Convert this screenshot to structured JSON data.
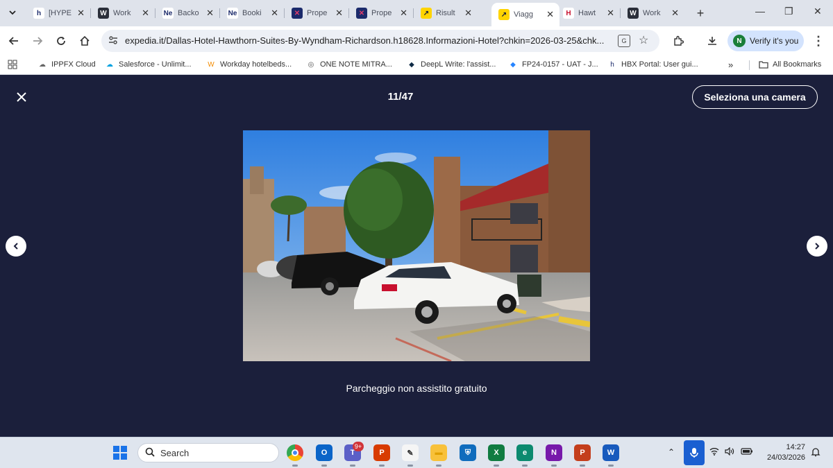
{
  "browser": {
    "tabs": [
      {
        "label": "[HYPE",
        "fav": "h",
        "fav_bg": "#ffffff",
        "fav_color": "#1b2a6b"
      },
      {
        "label": "Work",
        "fav": "W",
        "fav_bg": "#2b2f3a",
        "fav_color": "#ffffff"
      },
      {
        "label": "Backo",
        "fav": "Ne",
        "fav_bg": "#ffffff",
        "fav_color": "#1b2a6b"
      },
      {
        "label": "Booki",
        "fav": "Ne",
        "fav_bg": "#ffffff",
        "fav_color": "#1b2a6b"
      },
      {
        "label": "Prope",
        "fav": "✕",
        "fav_bg": "#1b2a6b",
        "fav_color": "#e23b6a"
      },
      {
        "label": "Prope",
        "fav": "✕",
        "fav_bg": "#1b2a6b",
        "fav_color": "#e23b6a"
      },
      {
        "label": "Risult",
        "fav": "↗",
        "fav_bg": "#ffd400",
        "fav_color": "#1b1f3b"
      },
      {
        "label": "Viagg",
        "fav": "↗",
        "fav_bg": "#ffd400",
        "fav_color": "#1b1f3b"
      },
      {
        "label": "Hawt",
        "fav": "H",
        "fav_bg": "#ffffff",
        "fav_color": "#c8102e"
      },
      {
        "label": "Work",
        "fav": "W",
        "fav_bg": "#2b2f3a",
        "fav_color": "#ffffff"
      }
    ],
    "active_tab": 7,
    "url": "expedia.it/Dallas-Hotel-Hawthorn-Suites-By-Wyndham-Richardson.h18628.Informazioni-Hotel?chkin=2026-03-25&chk...",
    "verify_label": "Verify it's you",
    "bookmarks": [
      {
        "label": "IPPFX Cloud",
        "icon": "☁",
        "icon_color": "#666"
      },
      {
        "label": "Salesforce - Unlimit...",
        "icon": "☁",
        "icon_color": "#00a1e0"
      },
      {
        "label": "Workday hotelbeds...",
        "icon": "W",
        "icon_color": "#f38b00"
      },
      {
        "label": "ONE NOTE MITRA...",
        "icon": "◎",
        "icon_color": "#555"
      },
      {
        "label": "DeepL Write: l'assist...",
        "icon": "◆",
        "icon_color": "#0f2b46"
      },
      {
        "label": "FP24-0157 - UAT - J...",
        "icon": "◆",
        "icon_color": "#2684ff"
      },
      {
        "label": "HBX Portal: User gui...",
        "icon": "h",
        "icon_color": "#1b2a6b"
      }
    ],
    "more_bookmarks": "»",
    "all_bookmarks": "All Bookmarks"
  },
  "gallery": {
    "counter": "11/47",
    "select_room": "Seleziona una camera",
    "caption": "Parcheggio non assistito gratuito"
  },
  "taskbar": {
    "search_placeholder": "Search",
    "apps": [
      {
        "name": "chrome-icon",
        "glyph": "",
        "bg": "#ffffff",
        "color": "#fff"
      },
      {
        "name": "outlook-icon",
        "glyph": "O",
        "bg": "#0a64c8",
        "color": "#fff"
      },
      {
        "name": "teams-icon",
        "glyph": "T",
        "bg": "#5b5fc7",
        "color": "#fff"
      },
      {
        "name": "ppt-viewer-icon",
        "glyph": "P",
        "bg": "#d83b01",
        "color": "#fff"
      },
      {
        "name": "pen-icon",
        "glyph": "✎",
        "bg": "#f5f5f5",
        "color": "#333"
      },
      {
        "name": "file-explorer-icon",
        "glyph": "▬",
        "bg": "#f8c13a",
        "color": "#e0a000"
      },
      {
        "name": "defender-icon",
        "glyph": "⛨",
        "bg": "#0f6cbd",
        "color": "#fff"
      },
      {
        "name": "excel-icon",
        "glyph": "X",
        "bg": "#107c41",
        "color": "#fff"
      },
      {
        "name": "edge-icon",
        "glyph": "e",
        "bg": "#0c8a6f",
        "color": "#fff"
      },
      {
        "name": "onenote-icon",
        "glyph": "N",
        "bg": "#7719aa",
        "color": "#fff"
      },
      {
        "name": "powerpoint-icon",
        "glyph": "P",
        "bg": "#c43e1c",
        "color": "#fff"
      },
      {
        "name": "word-icon",
        "glyph": "W",
        "bg": "#185abd",
        "color": "#fff"
      }
    ],
    "teams_badge": "9+",
    "time": "14:27",
    "date": "24/03/2026"
  }
}
